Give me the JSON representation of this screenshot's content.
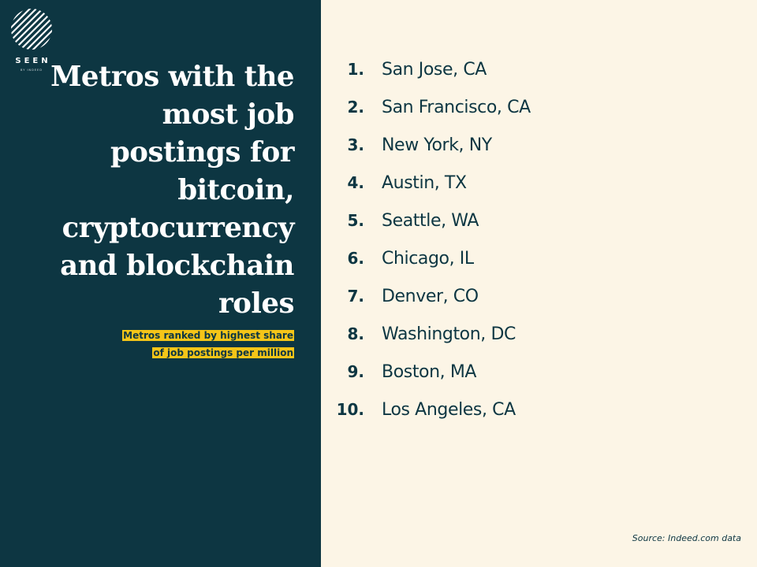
{
  "brand": {
    "name": "SEEN",
    "tagline": "BY INDEED"
  },
  "title": "Metros with the most job postings for bitcoin, cryptocurrency and blockchain roles",
  "subtitle": {
    "line1": "Metros ranked by highest share",
    "line2": "of job postings per million"
  },
  "rankings": [
    {
      "rank": "1.",
      "metro": "San Jose, CA"
    },
    {
      "rank": "2.",
      "metro": "San Francisco, CA"
    },
    {
      "rank": "3.",
      "metro": "New York, NY"
    },
    {
      "rank": "4.",
      "metro": "Austin, TX"
    },
    {
      "rank": "5.",
      "metro": "Seattle, WA"
    },
    {
      "rank": "6.",
      "metro": "Chicago, IL"
    },
    {
      "rank": "7.",
      "metro": "Denver, CO"
    },
    {
      "rank": "8.",
      "metro": "Washington, DC"
    },
    {
      "rank": "9.",
      "metro": "Boston, MA"
    },
    {
      "rank": "10.",
      "metro": "Los Angeles, CA"
    }
  ],
  "source": "Source: Indeed.com data",
  "colors": {
    "panel": "#0d3642",
    "background": "#fcf5e6",
    "highlight": "#f5c518",
    "text_dark": "#0d3642"
  },
  "icons": {
    "logo": "striped-circle-logo-icon"
  }
}
